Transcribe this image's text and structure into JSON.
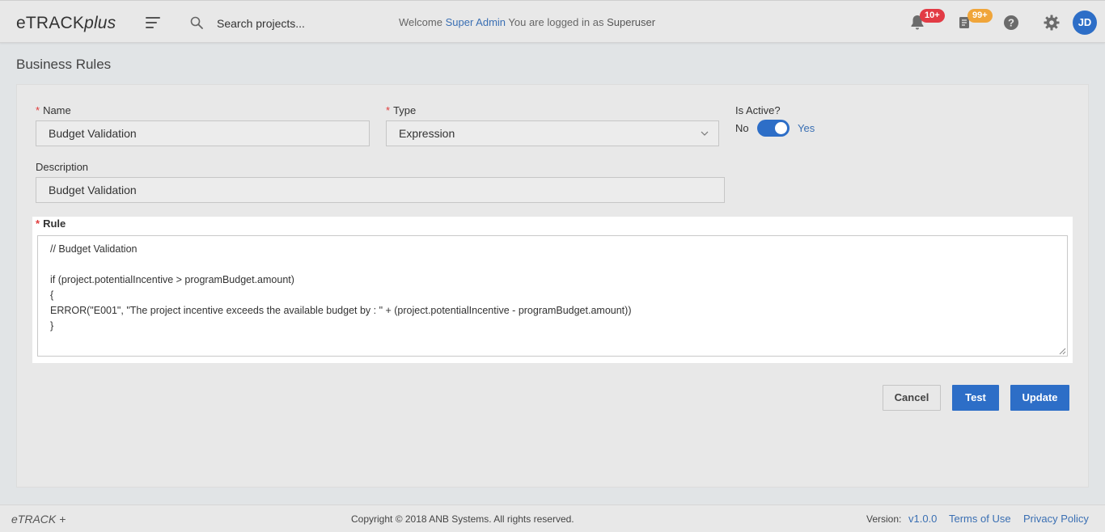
{
  "header": {
    "logo_main": "eTRACK",
    "logo_plus": "plus",
    "search_placeholder": "Search projects...",
    "welcome_prefix": "Welcome",
    "user_name": "Super Admin",
    "logged_in_text": "You are logged in as",
    "role": "Superuser",
    "notifications_badge": "10+",
    "tasks_badge": "99+",
    "avatar_initials": "JD",
    "icons": [
      "menu-icon",
      "search-icon",
      "bell-icon",
      "tasks-icon",
      "help-icon",
      "gear-icon"
    ]
  },
  "page": {
    "title": "Business Rules"
  },
  "form": {
    "name_label": "Name",
    "name_value": "Budget Validation",
    "type_label": "Type",
    "type_value": "Expression",
    "active_label": "Is Active?",
    "active_no": "No",
    "active_yes": "Yes",
    "active_state": true,
    "description_label": "Description",
    "description_value": "Budget Validation",
    "rule_label": "Rule",
    "rule_value": "// Budget Validation\n\nif (project.potentialIncentive > programBudget.amount)\n{\nERROR(\"E001\", \"The project incentive exceeds the available budget by : \" + (project.potentialIncentive - programBudget.amount))\n}",
    "required_marker": "*"
  },
  "actions": {
    "cancel": "Cancel",
    "test": "Test",
    "update": "Update"
  },
  "footer": {
    "logo": "eTRACK +",
    "copyright": "Copyright © 2018 ANB Systems. All rights reserved.",
    "version_label": "Version:",
    "version_value": "v1.0.0",
    "terms": "Terms of Use",
    "privacy": "Privacy Policy"
  },
  "colors": {
    "accent": "#2d6ec7",
    "link": "#3a6fb3",
    "required": "#e03a3a",
    "badge_red": "#e23b45",
    "badge_orange": "#f0a53a"
  }
}
